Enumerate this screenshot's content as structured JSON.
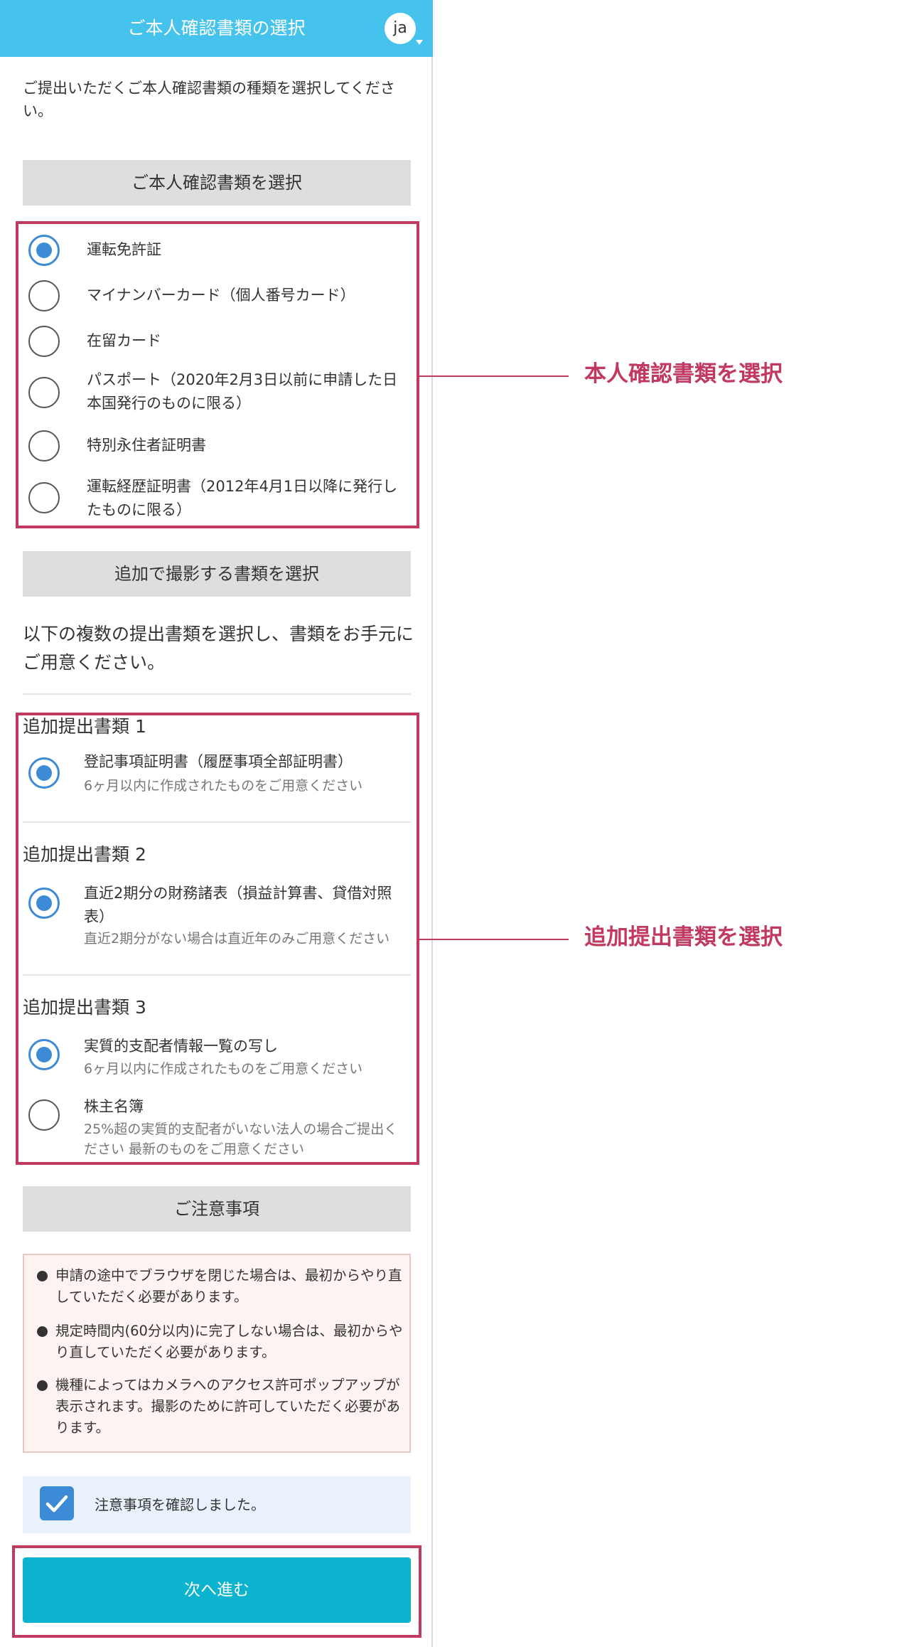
{
  "header": {
    "title": "ご本人確認書類の選択",
    "avatar_text": "ja"
  },
  "intro_text": "ご提出いただくご本人確認書類の種類を選択してください。",
  "id_section": {
    "heading": "ご本人確認書類を選択",
    "options": [
      {
        "label": "運転免許証",
        "checked": true
      },
      {
        "label": "マイナンバーカード（個人番号カード）",
        "checked": false
      },
      {
        "label": "在留カード",
        "checked": false
      },
      {
        "label": "パスポート（2020年2月3日以前に申請した日本国発行のものに限る）",
        "checked": false
      },
      {
        "label": "特別永住者証明書",
        "checked": false
      },
      {
        "label": "運転経歴証明書（2012年4月1日以降に発行したものに限る）",
        "checked": false
      }
    ]
  },
  "additional_section": {
    "heading": "追加で撮影する書類を選択",
    "description": "以下の複数の提出書類を選択し、書類をお手元にご用意ください。",
    "groups": [
      {
        "title": "追加提出書類 1",
        "options": [
          {
            "label": "登記事項証明書（履歴事項全部証明書）",
            "note": "6ヶ月以内に作成されたものをご用意ください",
            "checked": true
          }
        ]
      },
      {
        "title": "追加提出書類 2",
        "options": [
          {
            "label": "直近2期分の財務諸表（損益計算書、貸借対照表）",
            "note": "直近2期分がない場合は直近年のみご用意ください",
            "checked": true
          }
        ]
      },
      {
        "title": "追加提出書類 3",
        "options": [
          {
            "label": "実質的支配者情報一覧の写し",
            "note": "6ヶ月以内に作成されたものをご用意ください",
            "checked": true
          },
          {
            "label": "株主名簿",
            "note": "25%超の実質的支配者がいない法人の場合ご提出ください 最新のものをご用意ください",
            "checked": false
          }
        ]
      }
    ]
  },
  "notice_section": {
    "heading": "ご注意事項",
    "items": [
      "申請の途中でブラウザを閉じた場合は、最初からやり直していただく必要があります。",
      "規定時間内(60分以内)に完了しない場合は、最初からやり直していただく必要があります。",
      "機種によってはカメラへのアクセス許可ポップアップが表示されます。撮影のために許可していただく必要があります。"
    ]
  },
  "confirm": {
    "label": "注意事項を確認しました。",
    "checked": true
  },
  "next_button_label": "次へ進む",
  "annotations": {
    "id_select": "本人確認書類を選択",
    "additional_select": "追加提出書類を選択"
  },
  "colors": {
    "header": "#45c3ec",
    "accent": "#3d8bd6",
    "annotation": "#c2395f",
    "button": "#0bb3cf"
  }
}
